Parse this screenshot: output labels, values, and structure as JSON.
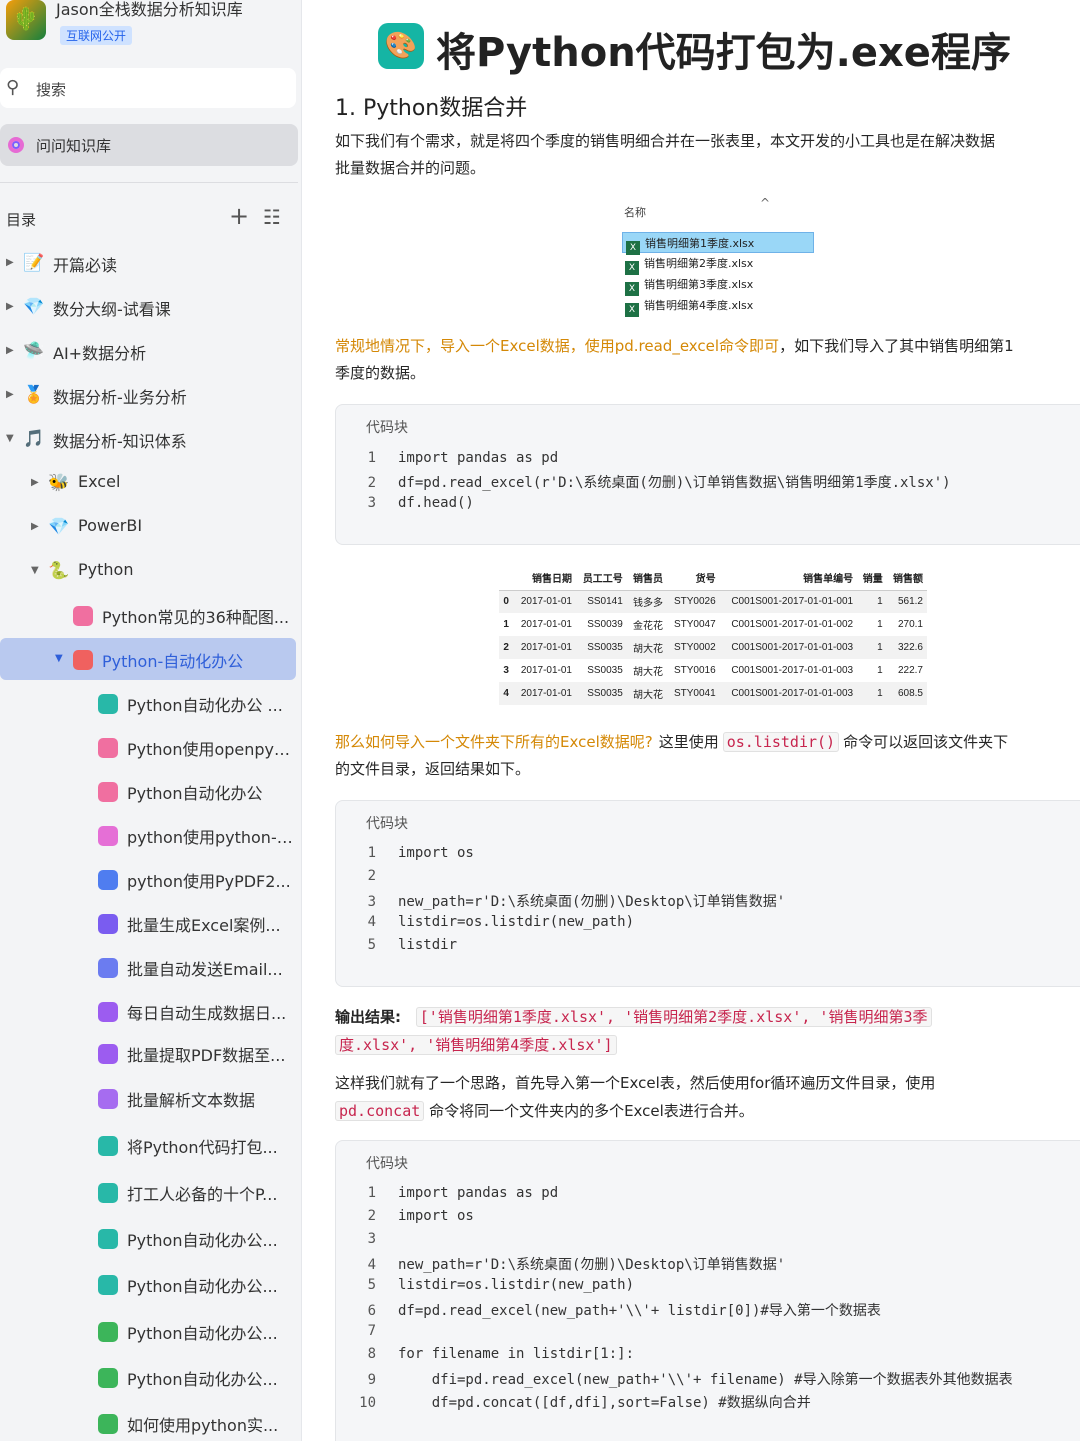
{
  "sidebar": {
    "kb_title": "Jason全栈数据分析知识库",
    "kb_badge": "互联网公开",
    "search_label": "搜索",
    "ask_label": "问问知识库",
    "toc_label": "目录",
    "add_glyph": "+",
    "list_glyph": "☷",
    "items": [
      {
        "label": "开篇必读",
        "icon": "📝"
      },
      {
        "label": "数分大纲-试看课",
        "icon": "💎"
      },
      {
        "label": "AI+数据分析",
        "icon": "🛸"
      },
      {
        "label": "数据分析-业务分析",
        "icon": "🏅"
      },
      {
        "label": "数据分析-知识体系",
        "icon": "🎵"
      },
      {
        "label": "Excel",
        "icon": "🐝"
      },
      {
        "label": "PowerBI",
        "icon": "💎"
      },
      {
        "label": "Python",
        "icon": "🐍"
      },
      {
        "label": "Python常见的36种配图...",
        "icon": "◘"
      },
      {
        "label": "Python-自动化办公",
        "icon": "◘"
      },
      {
        "label": "Python自动化办公 ...",
        "icon": "◘"
      },
      {
        "label": "Python使用openpyxl...",
        "icon": "◘"
      },
      {
        "label": "Python自动化办公",
        "icon": "◘"
      },
      {
        "label": "python使用python-d...",
        "icon": "◘"
      },
      {
        "label": "python使用PyPDF2...",
        "icon": "◘"
      },
      {
        "label": "批量生成Excel案例...",
        "icon": "◘"
      },
      {
        "label": "批量自动发送Email...",
        "icon": "◘"
      },
      {
        "label": "每日自动生成数据日...",
        "icon": "◘"
      },
      {
        "label": "批量提取PDF数据至...",
        "icon": "◘"
      },
      {
        "label": "批量解析文本数据",
        "icon": "◘"
      },
      {
        "label": "将Python代码打包...",
        "icon": "◘"
      },
      {
        "label": "打工人必备的十个P...",
        "icon": "◘"
      },
      {
        "label": "Python自动化办公...",
        "icon": "◘"
      },
      {
        "label": "Python自动化办公...",
        "icon": "◘"
      },
      {
        "label": "Python自动化办公...",
        "icon": "◘"
      },
      {
        "label": "Python自动化办公...",
        "icon": "◘"
      },
      {
        "label": "如何使用python实...",
        "icon": "◘"
      }
    ]
  },
  "doc": {
    "title": "将Python代码打包为.exe程序",
    "section1": "1. Python数据合并",
    "p1_line1": "如下我们有个需求，就是将四个季度的销售明细合并在一张表里，本文开发的小工具也是在解决数据",
    "p1_line2": "批量数据合并的问题。",
    "file_header": "名称",
    "files": [
      "销售明细第1季度.xlsx",
      "销售明细第2季度.xlsx",
      "销售明细第3季度.xlsx",
      "销售明细第4季度.xlsx"
    ],
    "p2_hl": "常规地情况下，导入一个Excel数据，使用pd.read_excel命令即可",
    "p2_rest": "，如下我们导入了其中销售明细第1",
    "p2_line2": "季度的数据。",
    "code_label": "代码块",
    "code1": [
      {
        "n": "1",
        "code": "import pandas as pd"
      },
      {
        "n": "2",
        "code": "df=pd.read_excel(r'D:\\系统桌面(勿删)\\订单销售数据\\销售明细第1季度.xlsx')"
      },
      {
        "n": "3",
        "code": "df.head()"
      }
    ],
    "table_headers": [
      "",
      "销售日期",
      "员工工号",
      "销售员",
      "货号",
      "销售单编号",
      "销量",
      "销售额"
    ],
    "table_rows": [
      [
        "0",
        "2017-01-01",
        "SS0141",
        "钱多多",
        "STY0026",
        "C001S001-2017-01-01-001",
        "1",
        "561.2"
      ],
      [
        "1",
        "2017-01-01",
        "SS0039",
        "金花花",
        "STY0047",
        "C001S001-2017-01-01-002",
        "1",
        "270.1"
      ],
      [
        "2",
        "2017-01-01",
        "SS0035",
        "胡大花",
        "STY0002",
        "C001S001-2017-01-01-003",
        "1",
        "322.6"
      ],
      [
        "3",
        "2017-01-01",
        "SS0035",
        "胡大花",
        "STY0016",
        "C001S001-2017-01-01-003",
        "1",
        "222.7"
      ],
      [
        "4",
        "2017-01-01",
        "SS0035",
        "胡大花",
        "STY0041",
        "C001S001-2017-01-01-003",
        "1",
        "608.5"
      ]
    ],
    "p3_hl": "那么如何导入一个文件夹下所有的Excel数据呢?",
    "p3_mid": "这里使用",
    "p3_code": "os.listdir()",
    "p3_rest": "命令可以返回该文件夹下",
    "p3_line2": "的文件目录，返回结果如下。",
    "code2": [
      {
        "n": "1",
        "code": "import os"
      },
      {
        "n": "2",
        "code": ""
      },
      {
        "n": "3",
        "code": "new_path=r'D:\\系统桌面(勿删)\\Desktop\\订单销售数据'"
      },
      {
        "n": "4",
        "code": "listdir=os.listdir(new_path)"
      },
      {
        "n": "5",
        "code": "listdir"
      }
    ],
    "out_label": "输出结果:",
    "out_line1": "['销售明细第1季度.xlsx', '销售明细第2季度.xlsx', '销售明细第3季",
    "out_line2": "度.xlsx', '销售明细第4季度.xlsx']",
    "p4_line1": "这样我们就有了一个思路，首先导入第一个Excel表，然后使用for循环遍历文件目录，使用",
    "p4_code": "pd.concat",
    "p4_rest": "命令将同一个文件夹内的多个Excel表进行合并。",
    "code3": [
      {
        "n": "1",
        "code": "import pandas as pd"
      },
      {
        "n": "2",
        "code": "import os"
      },
      {
        "n": "3",
        "code": ""
      },
      {
        "n": "4",
        "code": "new_path=r'D:\\系统桌面(勿删)\\Desktop\\订单销售数据'"
      },
      {
        "n": "5",
        "code": "listdir=os.listdir(new_path)"
      },
      {
        "n": "6",
        "code": "df=pd.read_excel(new_path+'\\\\'+ listdir[0])#导入第一个数据表"
      },
      {
        "n": "7",
        "code": ""
      },
      {
        "n": "8",
        "code": "for filename in listdir[1:]:"
      },
      {
        "n": "9",
        "code": "    dfi=pd.read_excel(new_path+'\\\\'+ filename) #导入除第一个数据表外其他数据表"
      },
      {
        "n": "10",
        "code": "    df=pd.concat([df,dfi],sort=False) #数据纵向合并"
      }
    ]
  },
  "colors": {
    "accent": "#2f5fd9",
    "highlight": "#d48806",
    "code_red": "#c7254e"
  }
}
